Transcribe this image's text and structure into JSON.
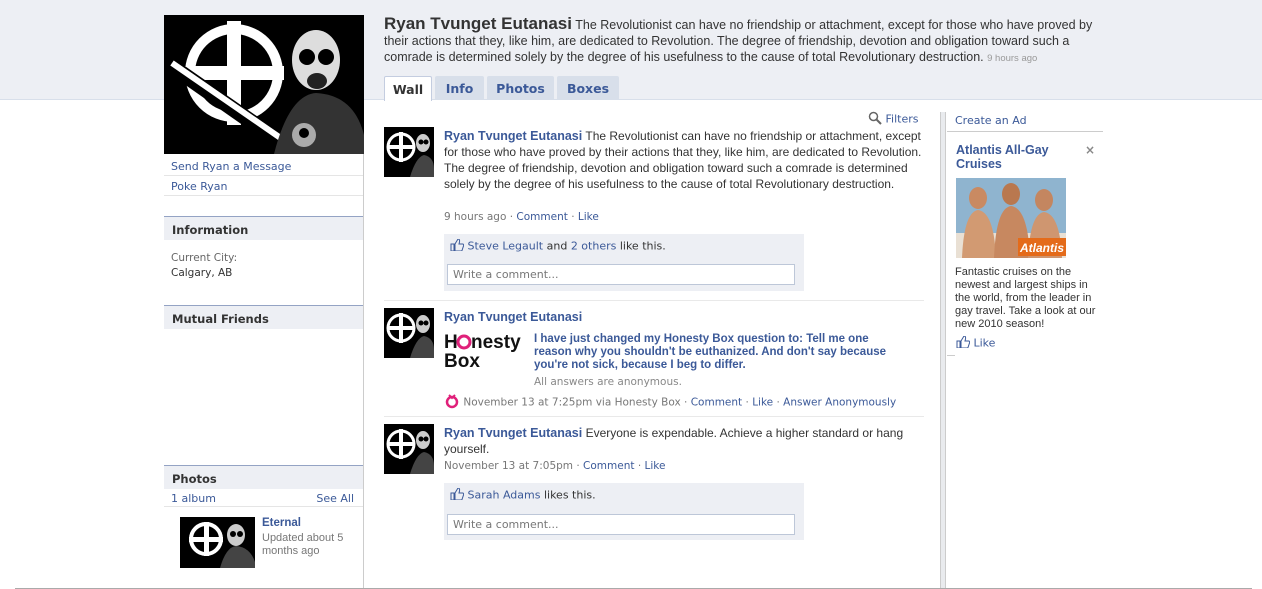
{
  "header": {
    "name": "Ryan Tvunget Eutanasi",
    "status": "The Revolutionist can have no friendship or attachment, except for those who have proved by their actions that they, like him, are dedicated to Revolution. The degree of friendship, devotion and obligation toward such a comrade is determined solely by the degree of his usefulness to the cause of total Revolutionary destruction.",
    "time": "9 hours ago"
  },
  "tabs": [
    {
      "label": "Wall",
      "active": true
    },
    {
      "label": "Info",
      "active": false
    },
    {
      "label": "Photos",
      "active": false
    },
    {
      "label": "Boxes",
      "active": false
    }
  ],
  "sidebar": {
    "send_message": "Send Ryan a Message",
    "poke": "Poke Ryan",
    "information": {
      "title": "Information",
      "city_label": "Current City:",
      "city_value": "Calgary, AB"
    },
    "mutual_friends": {
      "title": "Mutual Friends"
    },
    "photos": {
      "title": "Photos",
      "album_count": "1 album",
      "see_all": "See All",
      "album_name": "Eternal",
      "album_updated": "Updated about 5 months ago"
    }
  },
  "feed": {
    "filters": "Filters",
    "comment_placeholder": "Write a comment...",
    "posts": [
      {
        "author": "Ryan Tvunget Eutanasi",
        "text": "The Revolutionist can have no friendship or attachment, except for those who have proved by their actions that they, like him, are dedicated to Revolution. The degree of friendship, devotion and obligation toward such a comrade is determined solely by the degree of his usefulness to the cause of total Revolutionary destruction.",
        "time": "9 hours ago",
        "comment": "Comment",
        "like": "Like",
        "liker": "Steve Legault",
        "and": "and",
        "others": "2 others",
        "likes_suffix": "like this."
      },
      {
        "author": "Ryan Tvunget Eutanasi",
        "app_logo_text": "Honesty Box",
        "question": "I have just changed my Honesty Box question to: Tell me one reason why you shouldn't be euthanized. And don't say because you're not sick, because I beg to differ.",
        "anon_note": "All answers are anonymous.",
        "time": "November 13 at 7:25pm via Honesty Box",
        "comment": "Comment",
        "like": "Like",
        "answer": "Answer Anonymously"
      },
      {
        "author": "Ryan Tvunget Eutanasi",
        "text": "Everyone is expendable. Achieve a higher standard or hang yourself.",
        "time": "November 13 at 7:05pm",
        "comment": "Comment",
        "like": "Like",
        "liker": "Sarah Adams",
        "likes_suffix": "likes this."
      }
    ]
  },
  "ad": {
    "create": "Create an Ad",
    "title": "Atlantis All-Gay Cruises",
    "logo_text": "Atlantis",
    "body": "Fantastic cruises on the newest and largest ships in the world, from the leader in gay travel. Take a look at our new 2010 season!",
    "like": "Like",
    "close": "×"
  },
  "colors": {
    "link": "#3b5998",
    "band": "#edeff4",
    "honesty_pink": "#e0207a"
  }
}
